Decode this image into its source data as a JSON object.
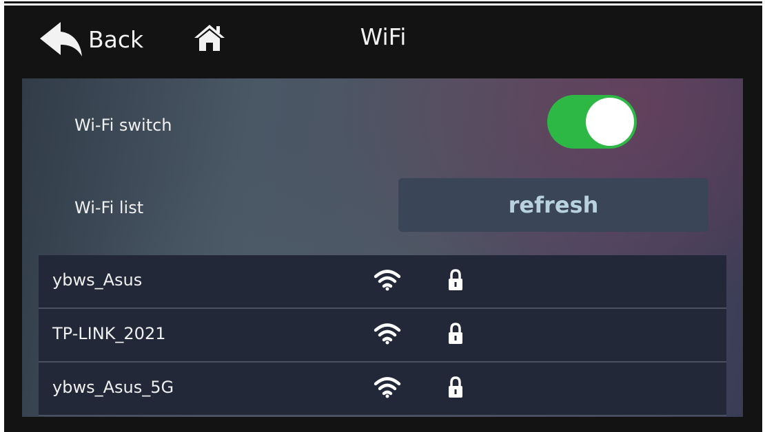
{
  "header": {
    "back_label": "Back",
    "title": "WiFi",
    "back_icon": "back-arrow-icon",
    "home_icon": "home-icon"
  },
  "settings": {
    "wifi_switch_label": "Wi-Fi switch",
    "wifi_switch_on": true,
    "wifi_list_label": "Wi-Fi list",
    "refresh_label": "refresh"
  },
  "networks": [
    {
      "ssid": "ybws_Asus",
      "signal_icon": "wifi-signal-icon",
      "lock_icon": "lock-icon",
      "secured": true
    },
    {
      "ssid": "TP-LINK_2021",
      "signal_icon": "wifi-signal-icon",
      "lock_icon": "lock-icon",
      "secured": true
    },
    {
      "ssid": "ybws_Asus_5G",
      "signal_icon": "wifi-signal-icon",
      "lock_icon": "lock-icon",
      "secured": true
    }
  ],
  "colors": {
    "screen_background": "#131313",
    "toggle_on": "#2db845",
    "refresh_button": "#3a4558",
    "refresh_text": "#b8d2e0",
    "list_row": "#222838"
  }
}
